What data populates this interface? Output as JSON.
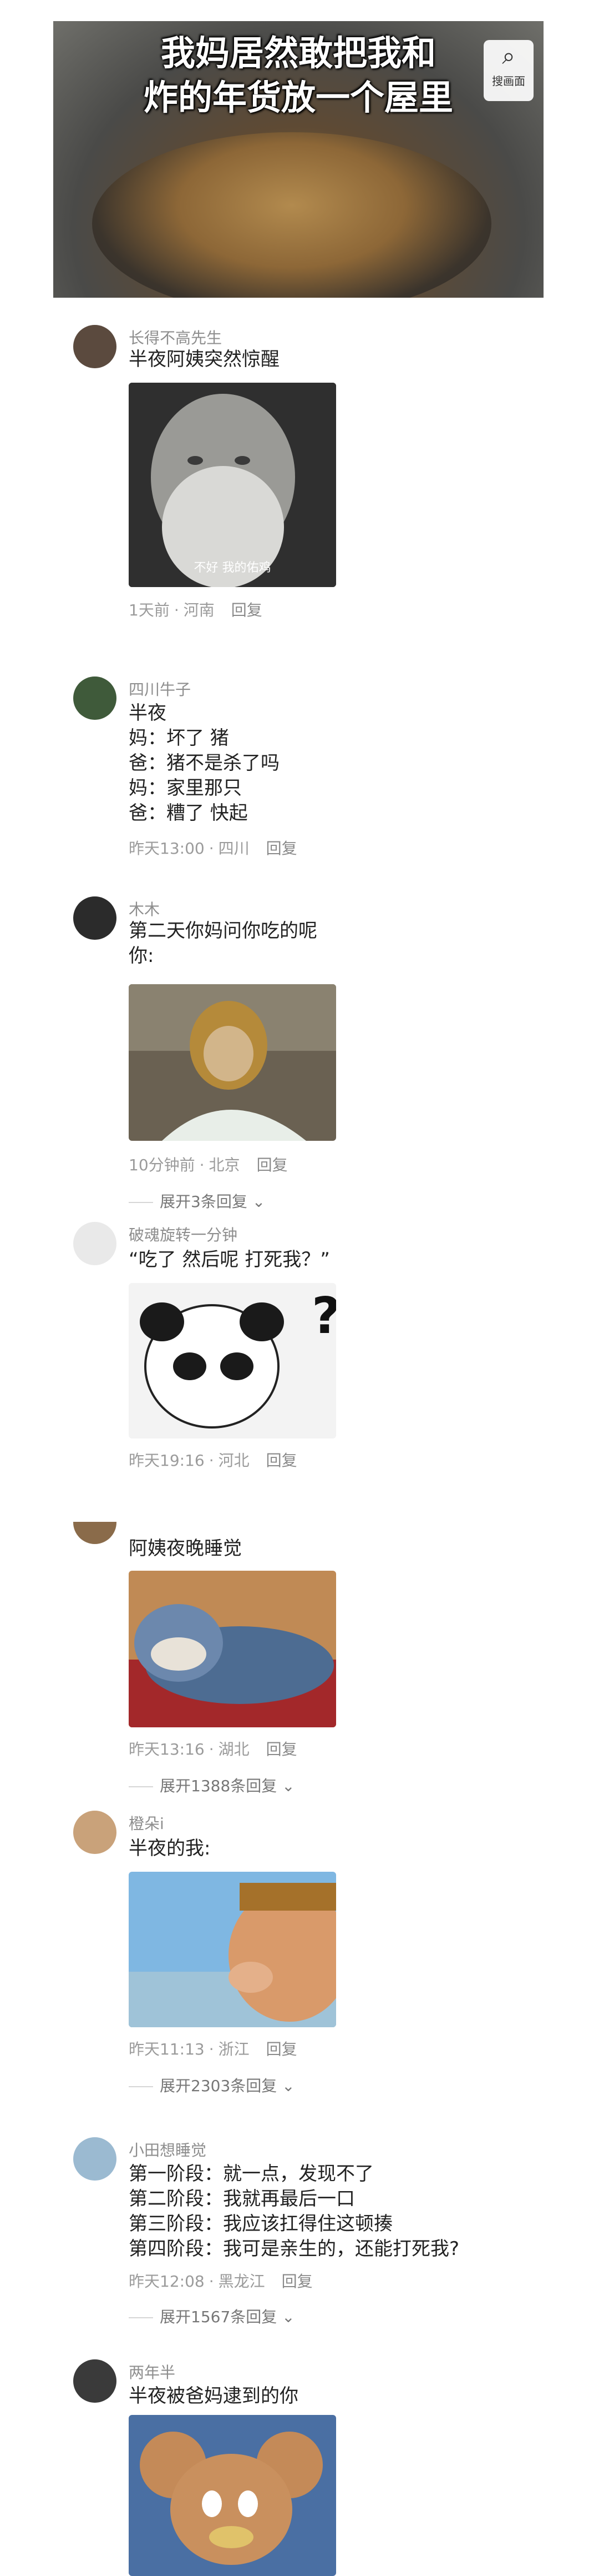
{
  "hero": {
    "title_line1": "我妈居然敢把我和",
    "title_line2": "炸的年货放一个屋里",
    "search_label": "搜画面"
  },
  "comments": [
    {
      "user": "长得不高先生",
      "lines": [
        "半夜阿姨突然惊醒"
      ],
      "image_caption": "不好 我的佑鸡",
      "time": "1天前",
      "location": "河南",
      "reply": "回复"
    },
    {
      "user": "四川牛子",
      "lines": [
        "半夜",
        "妈：坏了 猪",
        "爸：猪不是杀了吗",
        "妈：家里那只",
        "爸：糟了 快起"
      ],
      "time": "昨天13:00",
      "location": "四川",
      "reply": "回复"
    },
    {
      "user": "木木",
      "lines": [
        "第二天你妈问你吃的呢",
        "你:"
      ],
      "time": "10分钟前",
      "location": "北京",
      "reply": "回复",
      "expand": "展开3条回复"
    },
    {
      "user": "破魂旋转一分钟",
      "lines": [
        "“吃了 然后呢 打死我？”"
      ],
      "time": "昨天19:16",
      "location": "河北",
      "reply": "回复"
    },
    {
      "user": "",
      "lines": [
        "阿姨夜晚睡觉"
      ],
      "time": "昨天13:16",
      "location": "湖北",
      "reply": "回复",
      "expand": "展开1388条回复"
    },
    {
      "user": "橙朵i",
      "lines": [
        "半夜的我:"
      ],
      "time": "昨天11:13",
      "location": "浙江",
      "reply": "回复",
      "expand": "展开2303条回复"
    },
    {
      "user": "小田想睡觉",
      "lines": [
        "第一阶段：就一点，发现不了",
        "第二阶段：我就再最后一口",
        "第三阶段：我应该扛得住这顿揍",
        "第四阶段：我可是亲生的，还能打死我?"
      ],
      "time": "昨天12:08",
      "location": "黑龙江",
      "reply": "回复",
      "expand": "展开1567条回复"
    },
    {
      "user": "两年半",
      "lines": [
        "半夜被爸妈逮到的你"
      ]
    }
  ]
}
